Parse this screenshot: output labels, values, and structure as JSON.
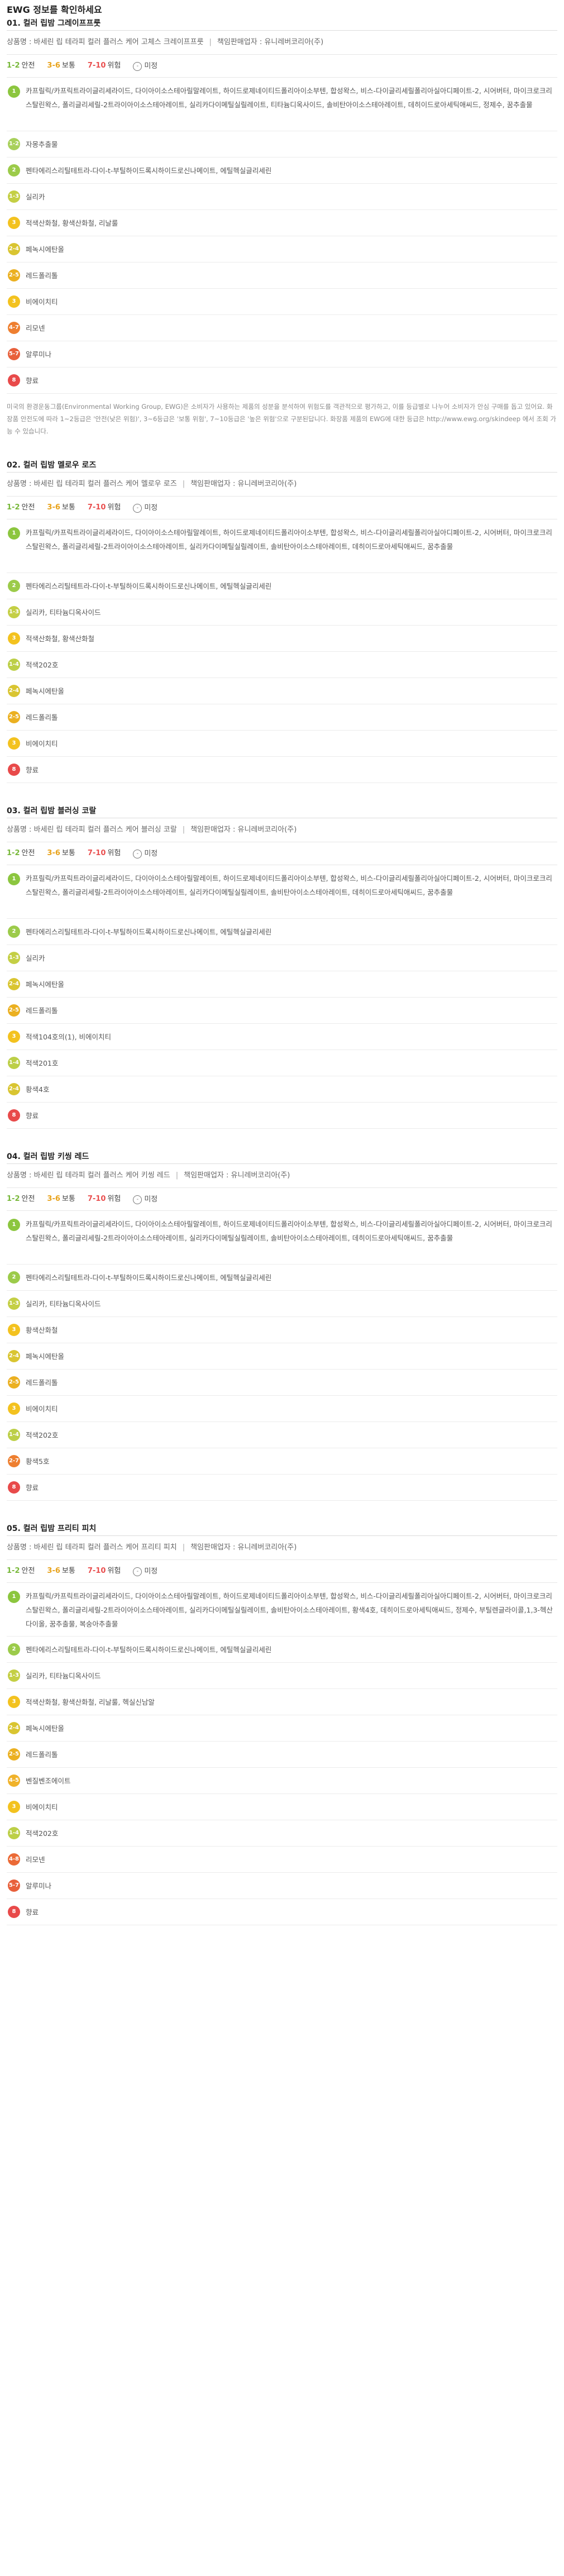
{
  "page": {
    "title": "EWG 정보를 확인하세요"
  },
  "colors": {
    "safe": "#78b83a",
    "moderate": "#e8a21a",
    "danger": "#e94f4f"
  },
  "legend": {
    "safe_range": "1-2",
    "safe_label": "안전",
    "moderate_range": "3-6",
    "moderate_label": "보통",
    "danger_range": "7-10",
    "danger_label": "위험",
    "na_symbol": "-",
    "na_label": "미정"
  },
  "sections": [
    {
      "title": "01. 컬러 립밤 그레이프프룻",
      "product": "상품명 : 바세린 립 테라피 컬러 플러스 케어 고체스 크레이프프룻",
      "vendor": "책임판매업자 : 유니레버코리아(주)",
      "rows": [
        {
          "grade": "1",
          "cls": "b1",
          "lines": 3,
          "text": "카프릴릭/카프릭트라이글리세라이드, 다이아이소스테아릴말레이트, 하이드로제네이티드폴리아이소부텐, 합성왁스, 비스-다이글리세릴폴리아실아디페이트-2, 시어버터, 마이크로크리스탈린왁스, 폴리글리세릴-2트라이아이소스테아레이트, 실리카다이메틸실릴레이트, 티타늄디옥사이드, 솔비탄아이소스테아레이트, 데히이드로아세틱애씨드, 정제수, 꿈추출물"
        },
        {
          "grade": "1-2",
          "cls": "b12",
          "lines": 1,
          "text": "자몽추출물"
        },
        {
          "grade": "2",
          "cls": "b2",
          "lines": 1,
          "text": "펜타에리스리틸테트라-다이-t-부틸하이드록시하이드로신나메이트, 에틸헥실글리세린"
        },
        {
          "grade": "1-3",
          "cls": "b13",
          "lines": 1,
          "text": "실리카"
        },
        {
          "grade": "3",
          "cls": "b3",
          "lines": 1,
          "text": "적색산화철, 황색산화철, 리날룰"
        },
        {
          "grade": "2-4",
          "cls": "b24",
          "lines": 1,
          "text": "페녹시에탄올"
        },
        {
          "grade": "2-5",
          "cls": "b25",
          "lines": 1,
          "text": "레드폴리톨"
        },
        {
          "grade": "3",
          "cls": "b3",
          "lines": 1,
          "text": "비에이치티"
        },
        {
          "grade": "4-7",
          "cls": "b47",
          "lines": 1,
          "text": "리모넨"
        },
        {
          "grade": "5-7",
          "cls": "b57",
          "lines": 1,
          "text": "알루미나"
        },
        {
          "grade": "8",
          "cls": "b8",
          "lines": 1,
          "text": "향료"
        }
      ],
      "note": "미국의 환경운동그룹(Environmental Working Group, EWG)은 소비자가 사용하는 제품의 성분을 분석하여 위험도를 객관적으로 평가하고, 이를 등급별로 나누어 소비자가 안심 구매를 돕고 있어요. 화장품 안전도에 따라 1~2등급은 '안전(낮은 위험)', 3~6등급은 '보통 위험', 7~10등급은 '높은 위험'으로 구분된답니다. 화장품 제품의 EWG에 대한 등급은 http://www.ewg.org/skindeep 에서 조회 가능 수 있습니다."
    },
    {
      "title": "02. 컬러 립밤 멜로우 로즈",
      "product": "상품명 : 바세린 립 테라피 컬러 플러스 케어 멜로우 로즈",
      "vendor": "책임판매업자 : 유니레버코리아(주)",
      "rows": [
        {
          "grade": "1",
          "cls": "b1",
          "lines": 3,
          "text": "카프릴릭/카프릭트라이글리세라이드, 다이아이소스테아릴말레이트, 하이드로제네이티드폴리아이소부텐, 합성왁스, 비스-다이글리세릴폴리아실아디페이트-2, 시어버터, 마이크로크리스탈린왁스, 폴리글리세릴-2트라이아이소스테아레이트, 실리카다이메틸실릴레이트, 솔비탄아이소스테아레이트, 데히이드로아세틱애씨드, 꿈추출물"
        },
        {
          "grade": "2",
          "cls": "b2",
          "lines": 1,
          "text": "펜타에리스리틸테트라-다이-t-부틸하이드록시하이드로신나메이트, 에틸헥실글리세린"
        },
        {
          "grade": "1-3",
          "cls": "b13",
          "lines": 1,
          "text": "실리카, 티타늄디옥사이드"
        },
        {
          "grade": "3",
          "cls": "b3",
          "lines": 1,
          "text": "적색산화철, 황색산화철"
        },
        {
          "grade": "1-4",
          "cls": "b14",
          "lines": 1,
          "text": "적색202호"
        },
        {
          "grade": "2-4",
          "cls": "b24",
          "lines": 1,
          "text": "페녹시에탄올"
        },
        {
          "grade": "2-5",
          "cls": "b25",
          "lines": 1,
          "text": "레드폴리톨"
        },
        {
          "grade": "3",
          "cls": "b3",
          "lines": 1,
          "text": "비에이치티"
        },
        {
          "grade": "8",
          "cls": "b8",
          "lines": 1,
          "text": "향료"
        }
      ],
      "note": ""
    },
    {
      "title": "03. 컬러 립밤 블러싱 코랄",
      "product": "상품명 : 바세린 립 테라피 컬러 플러스 케어 블러싱 코랄",
      "vendor": "책임판매업자 : 유니레버코리아(주)",
      "rows": [
        {
          "grade": "1",
          "cls": "b1",
          "lines": 3,
          "text": "카프릴릭/카프릭트라이글리세라이드, 다이아이소스테아릴말레이트, 하이드로제네이티드폴리아이소부텐, 합성왁스, 비스-다이글리세릴폴리아실아디페이트-2, 시어버터, 마이크로크리스탈린왁스, 폴리글리세릴-2트라이아이소스테아레이트, 실리카다이메틸실릴레이트, 솔비탄아이소스테아레이트, 데히이드로아세틱애씨드, 꿈추출물"
        },
        {
          "grade": "2",
          "cls": "b2",
          "lines": 1,
          "text": "펜타에리스리틸테트라-다이-t-부틸하이드록시하이드로신나메이트, 에틸헥실글리세린"
        },
        {
          "grade": "1-3",
          "cls": "b13",
          "lines": 1,
          "text": "실리카"
        },
        {
          "grade": "2-4",
          "cls": "b24",
          "lines": 1,
          "text": "페녹시에탄올"
        },
        {
          "grade": "2-5",
          "cls": "b25",
          "lines": 1,
          "text": "레드폴리톨"
        },
        {
          "grade": "3",
          "cls": "b3",
          "lines": 1,
          "text": "적색104호의(1), 비에이치티"
        },
        {
          "grade": "1-4",
          "cls": "b14",
          "lines": 1,
          "text": "적색201호"
        },
        {
          "grade": "2-4",
          "cls": "b24",
          "lines": 1,
          "text": "황색4호"
        },
        {
          "grade": "8",
          "cls": "b8",
          "lines": 1,
          "text": "향료"
        }
      ],
      "note": ""
    },
    {
      "title": "04. 컬러 립밤 키씽 레드",
      "product": "상품명 : 바세린 립 테라피 컬러 플러스 케어 키씽 레드",
      "vendor": "책임판매업자 : 유니레버코리아(주)",
      "rows": [
        {
          "grade": "1",
          "cls": "b1",
          "lines": 3,
          "text": "카프릴릭/카프릭트라이글리세라이드, 다이아이소스테아릴말레이트, 하이드로제네이티드폴리아이소부텐, 합성왁스, 비스-다이글리세릴폴리아실아디페이트-2, 시어버터, 마이크로크리스탈린왁스, 폴리글리세릴-2트라이아이소스테아레이트, 실리카다이메틸실릴레이트, 솔비탄아이소스테아레이트, 데히이드로아세틱애씨드, 꿈추출물"
        },
        {
          "grade": "2",
          "cls": "b2",
          "lines": 1,
          "text": "펜타에리스리틸테트라-다이-t-부틸하이드록시하이드로신나메이트, 에틸헥실글리세린"
        },
        {
          "grade": "1-3",
          "cls": "b13",
          "lines": 1,
          "text": "실리카, 티타늄디옥사이드"
        },
        {
          "grade": "3",
          "cls": "b3",
          "lines": 1,
          "text": "황색산화철"
        },
        {
          "grade": "2-4",
          "cls": "b24",
          "lines": 1,
          "text": "페녹시에탄올"
        },
        {
          "grade": "2-5",
          "cls": "b25",
          "lines": 1,
          "text": "레드폴리톨"
        },
        {
          "grade": "3",
          "cls": "b3",
          "lines": 1,
          "text": "비에이치티"
        },
        {
          "grade": "1-4",
          "cls": "b14",
          "lines": 1,
          "text": "적색202호"
        },
        {
          "grade": "2-7",
          "cls": "b47",
          "lines": 1,
          "text": "황색5호"
        },
        {
          "grade": "8",
          "cls": "b8",
          "lines": 1,
          "text": "향료"
        }
      ],
      "note": ""
    },
    {
      "title": "05. 컬러 립밤 프리티 피치",
      "product": "상품명 : 바세린 립 테라피 컬러 플러스 케어 프리티 피치",
      "vendor": "책임판매업자 : 유니레버코리아(주)",
      "rows": [
        {
          "grade": "1",
          "cls": "b1",
          "lines": 3,
          "text": "카프릴릭/카프릭트라이글리세라이드, 다이아이소스테아릴말레이트, 하이드로제네이티드폴리아이소부텐, 합성왁스, 비스-다이글리세릴폴리아실아디페이트-2, 시어버터, 마이크로크리스탈린왁스, 폴리글리세릴-2트라이아이소스테아레이트, 실리카다이메틸실릴레이트, 솔비탄아이소스테아레이트, 황색4호, 데히이드로아세틱애씨드, 정제수, 부틸렌글라이콜,1,3-헥산다이올, 꿈추출물, 복숭아추출물"
        },
        {
          "grade": "2",
          "cls": "b2",
          "lines": 1,
          "text": "펜타에리스리틸테트라-다이-t-부틸하이드록시하이드로신나메이트, 에틸헥실글리세린"
        },
        {
          "grade": "1-3",
          "cls": "b13",
          "lines": 1,
          "text": "실리카, 티타늄디옥사이드"
        },
        {
          "grade": "3",
          "cls": "b3",
          "lines": 1,
          "text": "적색산화철, 황색산화철, 리날룰, 헥실신남알"
        },
        {
          "grade": "2-4",
          "cls": "b24",
          "lines": 1,
          "text": "페녹시에탄올"
        },
        {
          "grade": "2-5",
          "cls": "b25",
          "lines": 1,
          "text": "레드폴리톨"
        },
        {
          "grade": "4-5",
          "cls": "b35",
          "lines": 1,
          "text": "벤질벤조에이트"
        },
        {
          "grade": "3",
          "cls": "b3",
          "lines": 1,
          "text": "비에이치티"
        },
        {
          "grade": "1-4",
          "cls": "b14",
          "lines": 1,
          "text": "적색202호"
        },
        {
          "grade": "4-8",
          "cls": "b48",
          "lines": 1,
          "text": "리모넨"
        },
        {
          "grade": "5-7",
          "cls": "b57",
          "lines": 1,
          "text": "알루미나"
        },
        {
          "grade": "8",
          "cls": "b8",
          "lines": 1,
          "text": "향료"
        }
      ],
      "note": ""
    }
  ]
}
